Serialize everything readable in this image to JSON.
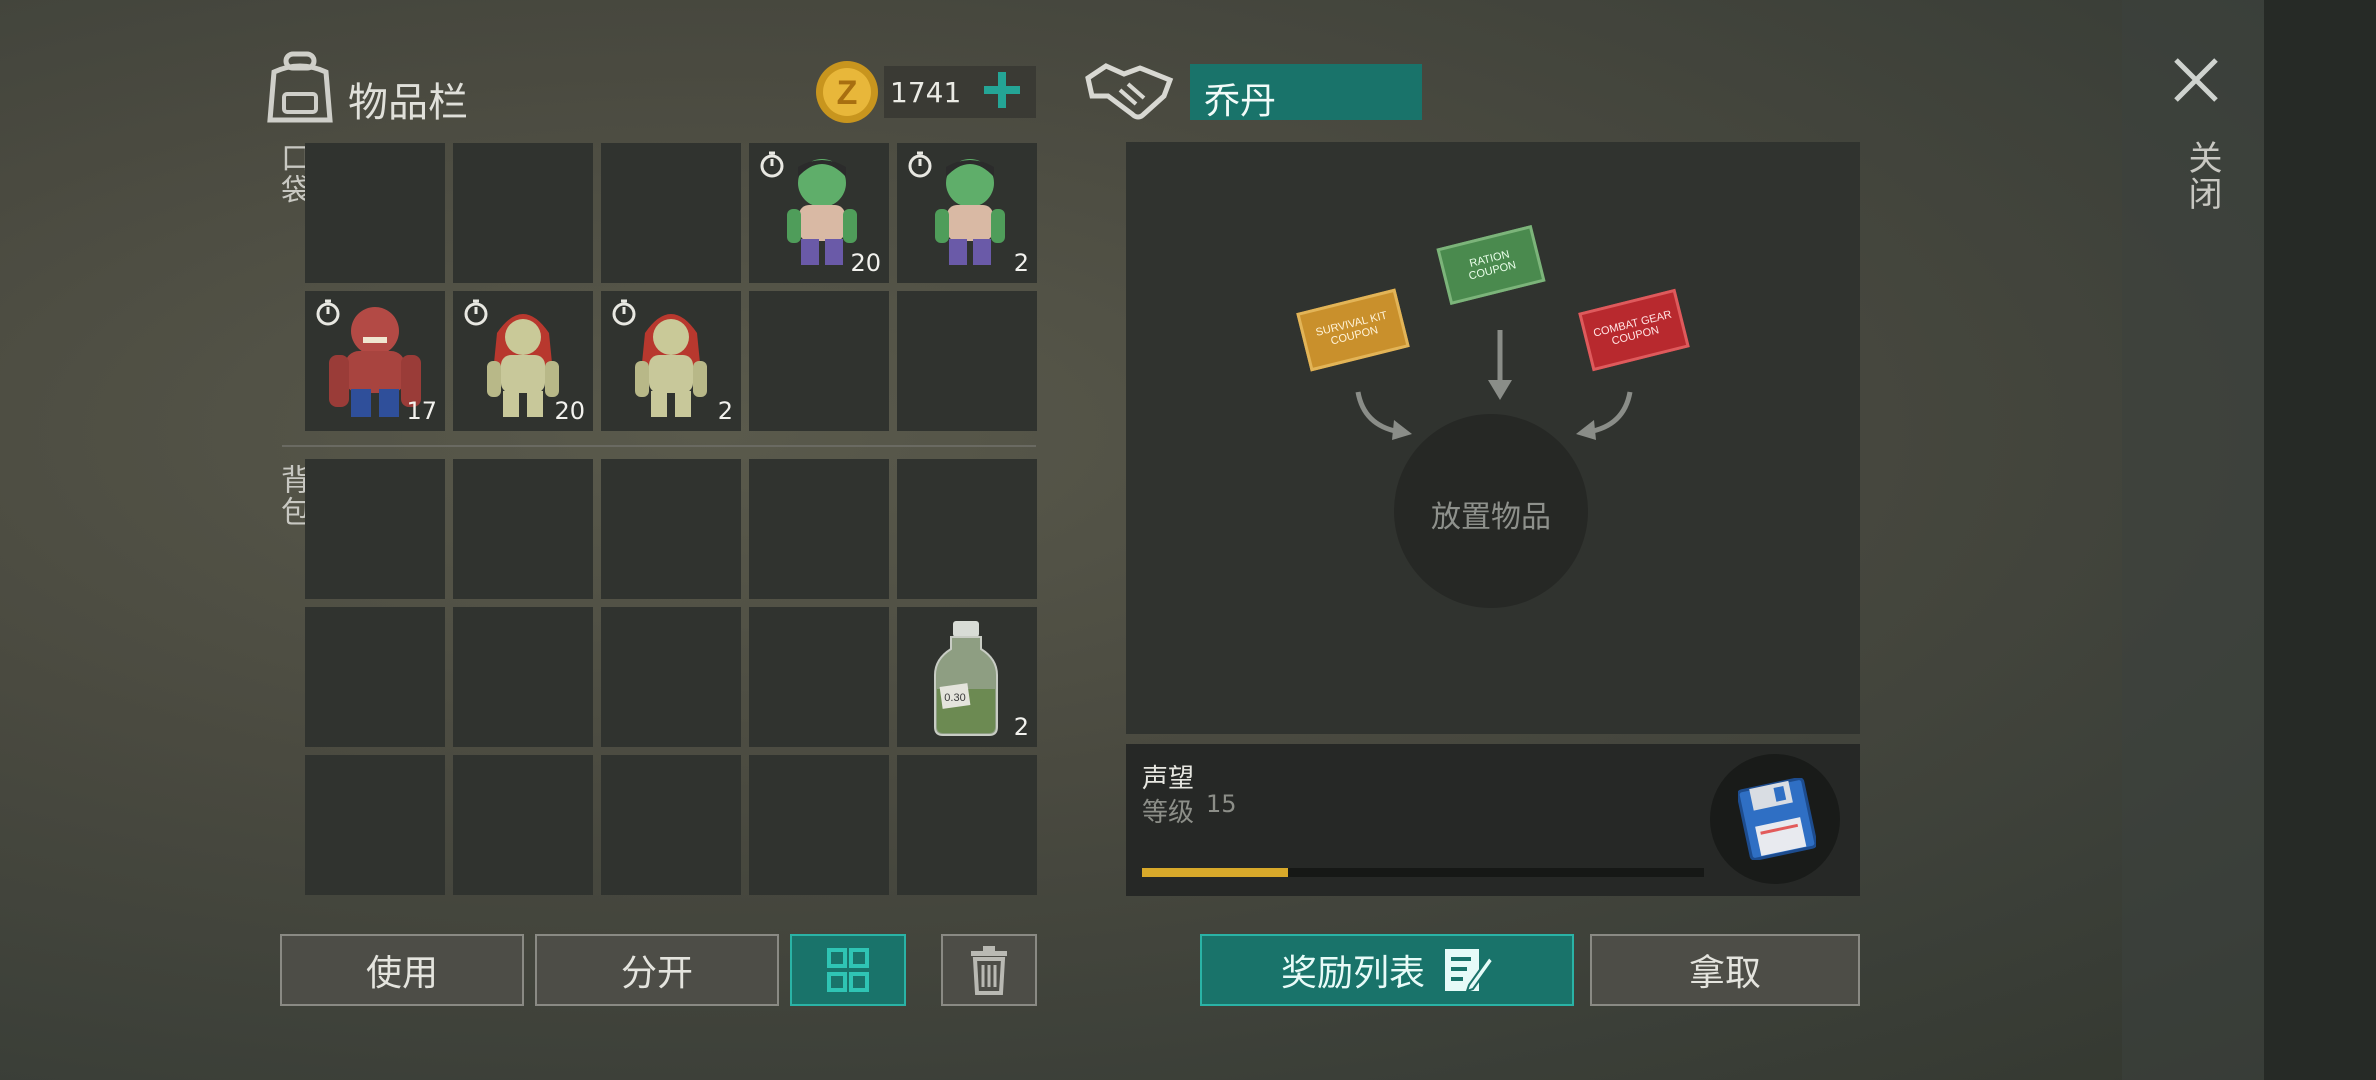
{
  "inventory": {
    "title": "物品栏",
    "coins": "1741",
    "pocket_label": "口袋",
    "backpack_label": "背包",
    "pocket_items": [
      {
        "slot": 3,
        "kind": "green-zombie",
        "count": "20"
      },
      {
        "slot": 4,
        "kind": "green-zombie",
        "count": "2"
      },
      {
        "slot": 5,
        "kind": "red-zombie",
        "count": "17"
      },
      {
        "slot": 6,
        "kind": "redhair-zombie",
        "count": "20"
      },
      {
        "slot": 7,
        "kind": "redhair-zombie",
        "count": "2"
      }
    ],
    "backpack_items": [
      {
        "slot": 9,
        "kind": "bottle",
        "count": "2",
        "label": "0.30"
      }
    ]
  },
  "trade": {
    "npc_name": "乔丹",
    "drop_hint": "放置物品",
    "coupons": [
      "SURVIVAL KIT COUPON",
      "RATION COUPON",
      "COMBAT GEAR COUPON"
    ],
    "reputation_title": "声望",
    "level_label": "等级",
    "level_value": "15",
    "progress": 0.26
  },
  "buttons": {
    "use": "使用",
    "split": "分开",
    "rewards": "奖励列表",
    "take": "拿取",
    "close": "关闭"
  },
  "colors": {
    "accent": "#19736a",
    "progress": "#d8a92a"
  }
}
